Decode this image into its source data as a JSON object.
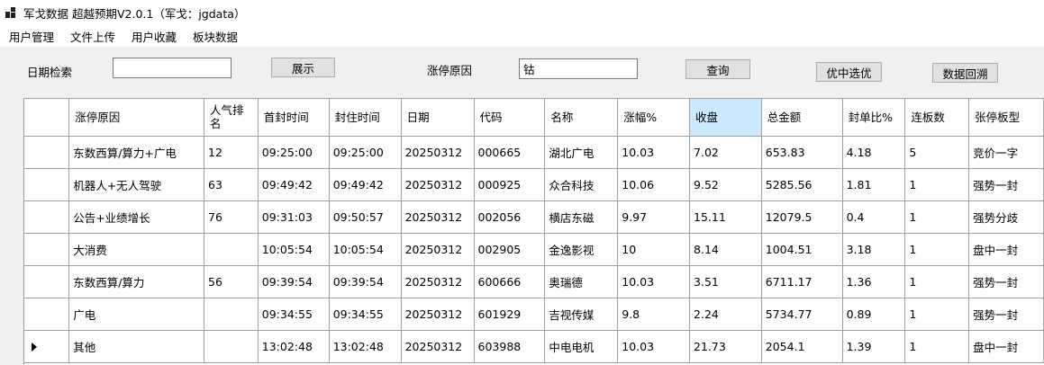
{
  "window": {
    "title": "军戈数据 超越预期V2.0.1（军戈：jgdata）",
    "icon": "app-grid-icon"
  },
  "menu": [
    "用户管理",
    "文件上传",
    "用户收藏",
    "板块数据"
  ],
  "toolbar": {
    "date_label": "日期检索",
    "date_value": "",
    "show_button": "展示",
    "reason_label": "涨停原因",
    "reason_value": "钴",
    "query_button": "查询",
    "pick_button": "优中选优",
    "backtrack_button": "数据回溯"
  },
  "table": {
    "columns": [
      "涨停原因",
      "人气排名",
      "首封时间",
      "封住时间",
      "日期",
      "代码",
      "名称",
      "涨幅%",
      "收盘",
      "总金额",
      "封单比%",
      "连板数",
      "张停板型"
    ],
    "sorted_column": "收盘",
    "current_row_index": 6,
    "rows": [
      [
        "东数西算/算力+广电",
        "12",
        "09:25:00",
        "09:25:00",
        "20250312",
        "000665",
        "湖北广电",
        "10.03",
        "7.02",
        "653.83",
        "4.18",
        "5",
        "竞价一字"
      ],
      [
        "机器人+无人驾驶",
        "63",
        "09:49:42",
        "09:49:42",
        "20250312",
        "000925",
        "众合科技",
        "10.06",
        "9.52",
        "5285.56",
        "1.81",
        "1",
        "强势一封"
      ],
      [
        "公告+业绩增长",
        "76",
        "09:31:03",
        "09:50:57",
        "20250312",
        "002056",
        "横店东磁",
        "9.97",
        "15.11",
        "12079.5",
        "0.4",
        "1",
        "强势分歧"
      ],
      [
        "大消费",
        "",
        "10:05:54",
        "10:05:54",
        "20250312",
        "002905",
        "金逸影视",
        "10",
        "8.14",
        "1004.51",
        "3.18",
        "1",
        "盘中一封"
      ],
      [
        "东数西算/算力",
        "56",
        "09:39:54",
        "09:39:54",
        "20250312",
        "600666",
        "奥瑞德",
        "10.03",
        "3.51",
        "6711.17",
        "1.36",
        "1",
        "强势一封"
      ],
      [
        "广电",
        "",
        "09:34:55",
        "09:34:55",
        "20250312",
        "601929",
        "吉视传媒",
        "9.8",
        "2.24",
        "5734.77",
        "0.89",
        "1",
        "强势一封"
      ],
      [
        "其他",
        "",
        "13:02:48",
        "13:02:48",
        "20250312",
        "603988",
        "中电电机",
        "10.03",
        "21.73",
        "2054.1",
        "1.39",
        "1",
        "盘中一封"
      ]
    ]
  }
}
